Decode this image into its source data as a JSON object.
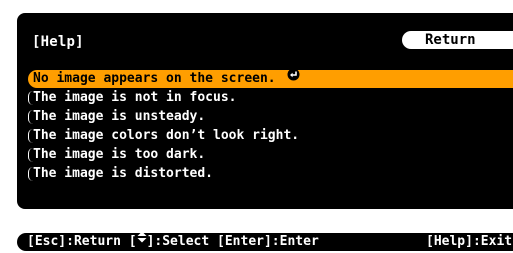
{
  "header": {
    "title": "[Help]",
    "return_label": "Return"
  },
  "menu": {
    "items": [
      {
        "label": "No image appears on the screen.",
        "selected": true
      },
      {
        "label": "The image is not in focus.",
        "selected": false
      },
      {
        "label": "The image is unsteady.",
        "selected": false
      },
      {
        "label": "The image colors don’t look right.",
        "selected": false
      },
      {
        "label": "The image is too dark.",
        "selected": false
      },
      {
        "label": "The image is distorted.",
        "selected": false
      }
    ],
    "selected_icon": "enter-icon"
  },
  "footer": {
    "esc_text": "[Esc]:Return [",
    "select_text": "]:Select [Enter]:Enter",
    "arrow_icon": "up-down-arrow-icon",
    "help_text": "[Help]:Exit"
  },
  "colors": {
    "panel": "#000000",
    "selected": "#ff9e00",
    "text": "#ffffff"
  }
}
